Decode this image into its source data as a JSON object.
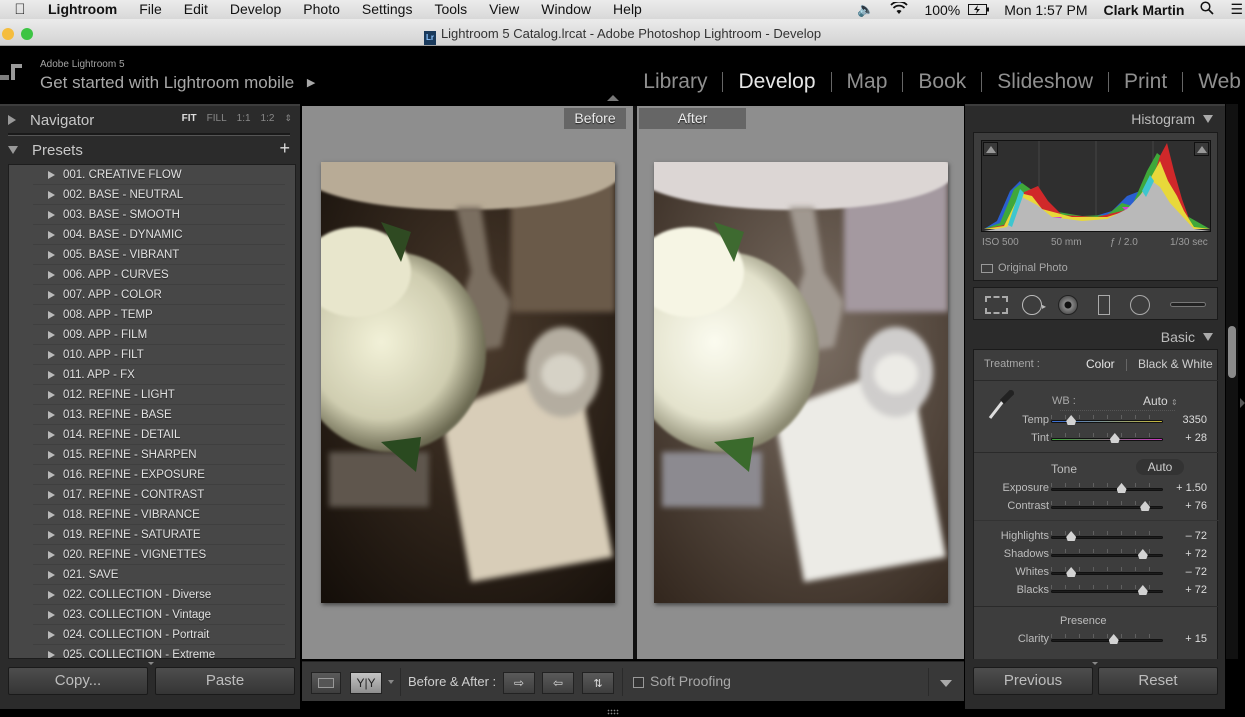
{
  "menubar": {
    "app_name": "Lightroom",
    "items": [
      "File",
      "Edit",
      "Develop",
      "Photo",
      "Settings",
      "Tools",
      "View",
      "Window",
      "Help"
    ],
    "battery": "100%",
    "clock": "Mon 1:57 PM",
    "user": "Clark Martin"
  },
  "window": {
    "title": "Lightroom 5 Catalog.lrcat - Adobe Photoshop Lightroom - Develop",
    "doc_icon": "Lr"
  },
  "identity": {
    "product": "Adobe Lightroom 5",
    "tagline": "Get started with Lightroom mobile"
  },
  "modules": [
    {
      "label": "Library",
      "active": false
    },
    {
      "label": "Develop",
      "active": true
    },
    {
      "label": "Map",
      "active": false
    },
    {
      "label": "Book",
      "active": false
    },
    {
      "label": "Slideshow",
      "active": false
    },
    {
      "label": "Print",
      "active": false
    },
    {
      "label": "Web",
      "active": false
    }
  ],
  "left_panel": {
    "navigator": {
      "title": "Navigator",
      "zoom_options": [
        "FIT",
        "FILL",
        "1:1",
        "1:2"
      ],
      "active_zoom": "FIT"
    },
    "presets": {
      "title": "Presets",
      "items": [
        "001. CREATIVE FLOW",
        "002. BASE - NEUTRAL",
        "003. BASE - SMOOTH",
        "004. BASE - DYNAMIC",
        "005. BASE - VIBRANT",
        "006. APP - CURVES",
        "007. APP - COLOR",
        "008. APP - TEMP",
        "009. APP - FILM",
        "010. APP - FILT",
        "011. APP - FX",
        "012. REFINE - LIGHT",
        "013. REFINE - BASE",
        "014. REFINE - DETAIL",
        "015. REFINE - SHARPEN",
        "016. REFINE - EXPOSURE",
        "017. REFINE - CONTRAST",
        "018. REFINE - VIBRANCE",
        "019. REFINE - SATURATE",
        "020. REFINE - VIGNETTES",
        "021. SAVE",
        "022. COLLECTION - Diverse",
        "023. COLLECTION - Vintage",
        "024. COLLECTION - Portrait",
        "025. COLLECTION - Extreme"
      ]
    },
    "copy_label": "Copy...",
    "paste_label": "Paste"
  },
  "center": {
    "before_label": "Before",
    "after_label": "After"
  },
  "toolbar": {
    "before_after_label": "Before & After :",
    "view_yy": "Y|Y",
    "soft_proofing_label": "Soft Proofing",
    "soft_proofing_checked": false
  },
  "right_panel": {
    "histogram": {
      "title": "Histogram",
      "iso": "ISO 500",
      "focal": "50 mm",
      "aperture": "ƒ / 2.0",
      "shutter": "1/30 sec",
      "original_photo_label": "Original Photo"
    },
    "basic": {
      "title": "Basic",
      "treatment_label": "Treatment :",
      "treatment_color": "Color",
      "treatment_bw": "Black & White",
      "wb_label": "WB :",
      "wb_value": "Auto",
      "tone_label": "Tone",
      "auto_label": "Auto",
      "presence_label": "Presence",
      "sliders": {
        "temp": {
          "label": "Temp",
          "value": "3350",
          "pos": 0.18
        },
        "tint": {
          "label": "Tint",
          "value": "+ 28",
          "pos": 0.57
        },
        "exposure": {
          "label": "Exposure",
          "value": "+ 1.50",
          "pos": 0.63
        },
        "contrast": {
          "label": "Contrast",
          "value": "+ 76",
          "pos": 0.84
        },
        "highlights": {
          "label": "Highlights",
          "value": "– 72",
          "pos": 0.18
        },
        "shadows": {
          "label": "Shadows",
          "value": "+ 72",
          "pos": 0.82
        },
        "whites": {
          "label": "Whites",
          "value": "– 72",
          "pos": 0.18
        },
        "blacks": {
          "label": "Blacks",
          "value": "+ 72",
          "pos": 0.82
        },
        "clarity": {
          "label": "Clarity",
          "value": "+ 15",
          "pos": 0.56
        }
      }
    },
    "previous_label": "Previous",
    "reset_label": "Reset"
  }
}
